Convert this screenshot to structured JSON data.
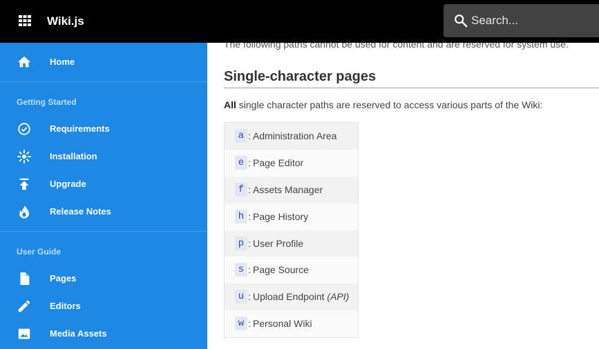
{
  "app": {
    "title": "Wiki.js"
  },
  "search": {
    "placeholder": "Search..."
  },
  "sidebar": {
    "top_items": [
      {
        "label": "Home",
        "icon": "home-icon"
      }
    ],
    "sections": [
      {
        "header": "Getting Started",
        "items": [
          {
            "label": "Requirements",
            "icon": "check-circle-icon"
          },
          {
            "label": "Installation",
            "icon": "installation-icon"
          },
          {
            "label": "Upgrade",
            "icon": "upgrade-icon"
          },
          {
            "label": "Release Notes",
            "icon": "fire-icon"
          }
        ]
      },
      {
        "header": "User Guide",
        "items": [
          {
            "label": "Pages",
            "icon": "file-icon"
          },
          {
            "label": "Editors",
            "icon": "pencil-icon"
          },
          {
            "label": "Media Assets",
            "icon": "image-icon"
          }
        ]
      }
    ]
  },
  "content": {
    "intro": "The following paths cannot be used for content and are reserved for system use.",
    "heading": "Single-character pages",
    "paragraph_bold": "All",
    "paragraph_rest": " single character paths are reserved to access various parts of the Wiki:",
    "paths": [
      {
        "code": "a",
        "sep": ":",
        "desc": "Administration Area",
        "extra": ""
      },
      {
        "code": "e",
        "sep": ":",
        "desc": "Page Editor",
        "extra": ""
      },
      {
        "code": "f",
        "sep": ":",
        "desc": "Assets Manager",
        "extra": ""
      },
      {
        "code": "h",
        "sep": ":",
        "desc": "Page History",
        "extra": ""
      },
      {
        "code": "p",
        "sep": ":",
        "desc": "User Profile",
        "extra": ""
      },
      {
        "code": "s",
        "sep": ":",
        "desc": "Page Source",
        "extra": ""
      },
      {
        "code": "u",
        "sep": ":",
        "desc": "Upload Endpoint",
        "extra": "(API)"
      },
      {
        "code": "w",
        "sep": ":",
        "desc": "Personal Wiki",
        "extra": ""
      }
    ]
  },
  "colors": {
    "topbar": "#000000",
    "sidebar": "#1e88e5",
    "search_bg": "#424242",
    "code_bg": "#e3e7f4"
  }
}
